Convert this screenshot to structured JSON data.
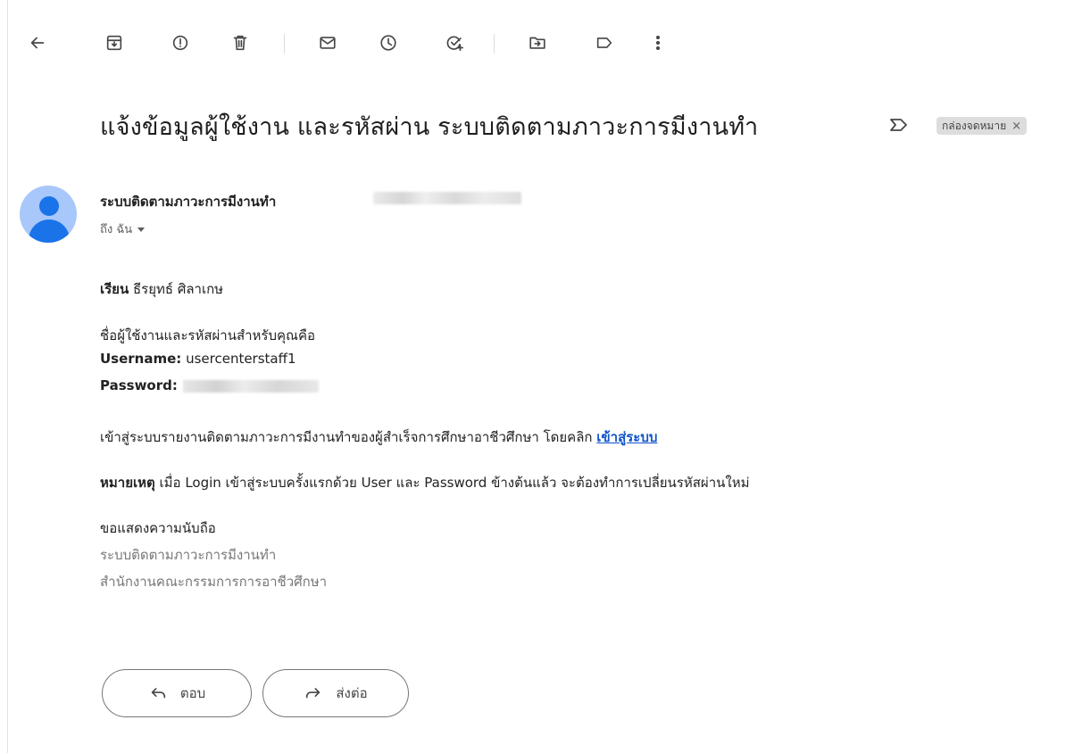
{
  "subject": {
    "title": "แจ้งข้อมูลผู้ใช้งาน และรหัสผ่าน ระบบติดตามภาวะการมีงานทำ",
    "label": "กล่องจดหมาย",
    "label_close": "×"
  },
  "toolbar": {
    "icons": [
      "back-arrow-icon",
      "archive-icon",
      "report-spam-icon",
      "delete-icon",
      "mark-unread-icon",
      "snooze-icon",
      "add-task-icon",
      "move-to-icon",
      "label-icon",
      "more-icon"
    ]
  },
  "sender": {
    "name": "ระบบติดตามภาวะการมีงานทำ",
    "to": "ถึง ฉัน"
  },
  "message": {
    "greeting_bold": "เรียน",
    "greeting_name": "ธีรยุทธ์ ศิลาเกษ",
    "intro": "ชื่อผู้ใช้งานและรหัสผ่านสำหรับคุณคือ",
    "username_label": "Username:",
    "username_value": "usercenterstaff1",
    "password_label": "Password:",
    "login_text": "เข้าสู่ระบบรายงานติดตามภาวะการมีงานทำของผู้สำเร็จการศึกษาอาชีวศึกษา โดยคลิก",
    "login_link": "เข้าสู่ระบบ",
    "note_bold": "หมายเหตุ",
    "note_text": "เมื่อ Login เข้าสู่ระบบครั้งแรกด้วย User และ Password ข้างต้นแล้ว จะต้องทำการเปลี่ยนรหัสผ่านใหม่",
    "closing": "ขอแสดงความนับถือ",
    "signature_line1": "ระบบติดตามภาวะการมีงานทำ",
    "signature_line2": "สำนักงานคณะกรรมการการอาชีวศึกษา"
  },
  "actions": {
    "reply_label": "ตอบ",
    "forward_label": "ส่งต่อ"
  }
}
